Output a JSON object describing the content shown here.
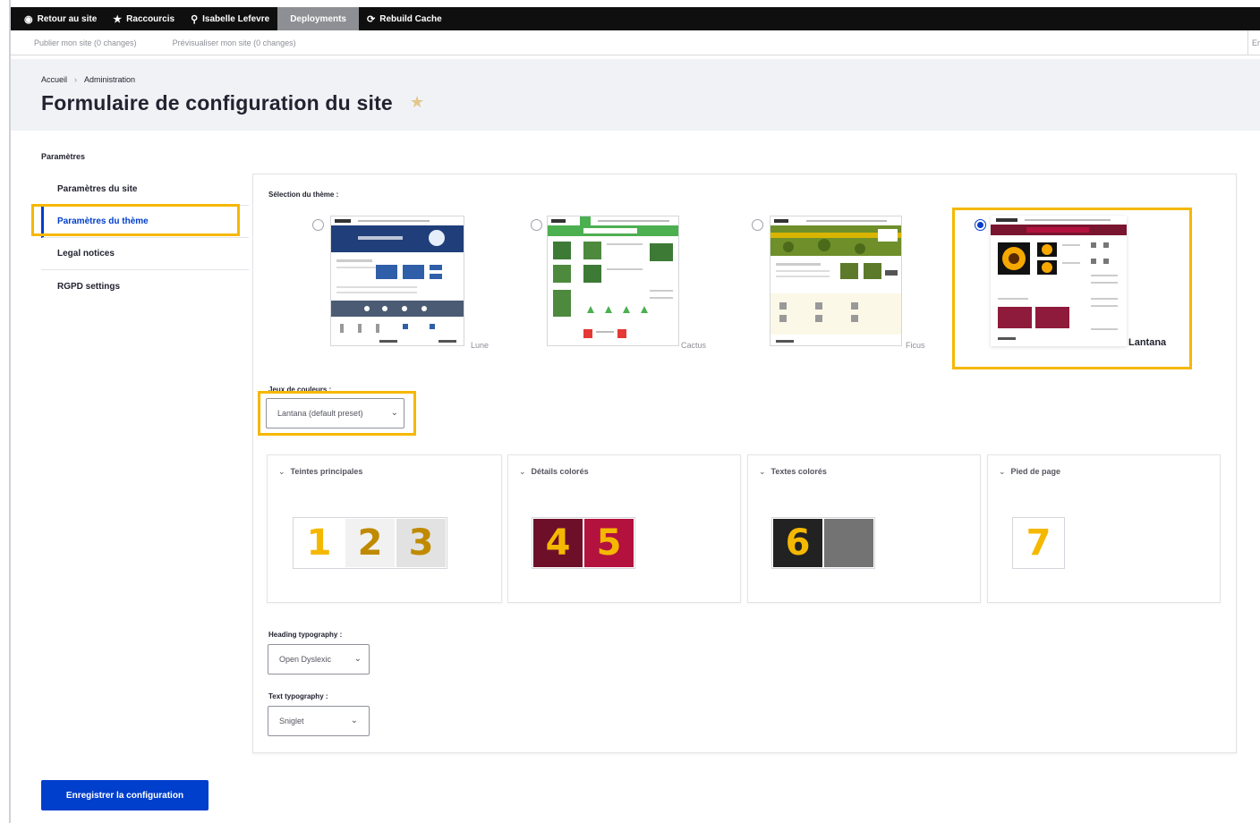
{
  "toolbar": {
    "back": "Retour au site",
    "shortcuts": "Raccourcis",
    "user": "Isabelle Lefevre",
    "deployments": "Deployments",
    "rebuild": "Rebuild Cache"
  },
  "subbar": {
    "publish": "Publier mon site (0 changes)",
    "preview": "Prévisualiser mon site (0 changes)",
    "right": "En"
  },
  "breadcrumb": [
    "Accueil",
    "Administration"
  ],
  "page_title": "Formulaire de configuration du site",
  "nav": {
    "title": "Paramètres",
    "items": [
      {
        "label": "Paramètres du site",
        "active": false
      },
      {
        "label": "Paramètres du thème",
        "active": true
      },
      {
        "label": "Legal notices",
        "active": false
      },
      {
        "label": "RGPD settings",
        "active": false
      }
    ]
  },
  "theme_section": {
    "label": "Sélection du thème :",
    "themes": [
      {
        "name": "Lune",
        "selected": false,
        "accent": "#2f5fa8"
      },
      {
        "name": "Cactus",
        "selected": false,
        "accent": "#4caf50"
      },
      {
        "name": "Ficus",
        "selected": false,
        "accent": "#8a9a2a"
      },
      {
        "name": "Lantana",
        "selected": true,
        "accent": "#7a1530"
      }
    ]
  },
  "color_preset": {
    "label": "Jeux de couleurs :",
    "value": "Lantana (default preset)"
  },
  "color_groups": [
    {
      "title": "Teintes principales",
      "swatches": [
        {
          "number": "1",
          "color": "#ffffff",
          "text_color": "#f5b800"
        },
        {
          "number": "2",
          "color": "#f1f1f1",
          "text_color": "#c08a00"
        },
        {
          "number": "3",
          "color": "#e2e2e2",
          "text_color": "#c08a00"
        }
      ]
    },
    {
      "title": "Détails colorés",
      "swatches": [
        {
          "number": "4",
          "color": "#6e0f2a",
          "text_color": "#f5b800"
        },
        {
          "number": "5",
          "color": "#b3123e",
          "text_color": "#f5b800"
        }
      ]
    },
    {
      "title": "Textes colorés",
      "swatches": [
        {
          "number": "6",
          "color": "#222222",
          "text_color": "#f5b800"
        },
        {
          "number": "",
          "color": "#737373",
          "text_color": "#f5b800"
        }
      ]
    },
    {
      "title": "Pied de page",
      "swatches": [
        {
          "number": "7",
          "color": "#ffffff",
          "text_color": "#f5b800"
        }
      ]
    }
  ],
  "heading_typography": {
    "label": "Heading typography :",
    "value": "Open Dyslexic"
  },
  "text_typography": {
    "label": "Text typography :",
    "value": "Sniglet"
  },
  "save_button": "Enregistrer la configuration",
  "colors": {
    "primary": "#003ecc",
    "highlight": "#f5b800",
    "toolbar": "#0f0f0f"
  }
}
